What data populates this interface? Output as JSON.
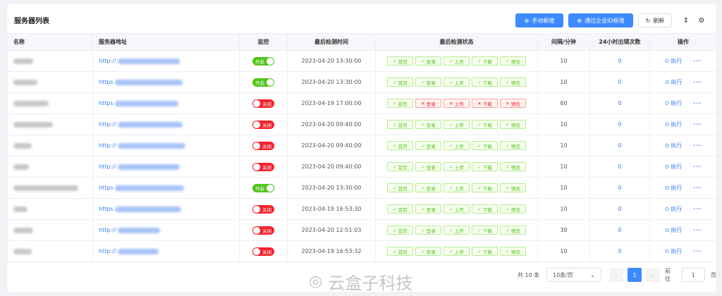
{
  "header": {
    "title": "服务器列表",
    "btn_manual_add": "手动新增",
    "btn_enterprise_add": "通过企业ID新增",
    "btn_refresh": "刷新"
  },
  "table": {
    "columns": [
      "名称",
      "服务器地址",
      "监控",
      "最后检测时间",
      "最后检测状态",
      "间隔/分钟",
      "24小时出错次数",
      "操作"
    ],
    "status_labels": [
      "首页",
      "登录",
      "上传",
      "下载",
      "预览"
    ],
    "action_label": "执行",
    "more_label": "···",
    "rows": [
      {
        "addr_prefix": "http://",
        "monitor": "开启",
        "monitor_on": true,
        "time": "2023-04-20 13:30:00",
        "status": [
          true,
          true,
          true,
          true,
          true
        ],
        "interval": "10",
        "errors": "0"
      },
      {
        "addr_prefix": "https",
        "monitor": "开启",
        "monitor_on": true,
        "time": "2023-04-20 13:30:00",
        "status": [
          true,
          true,
          true,
          true,
          true
        ],
        "interval": "10",
        "errors": "0"
      },
      {
        "addr_prefix": "https",
        "monitor": "关闭",
        "monitor_on": false,
        "time": "2023-04-19 17:00:00",
        "status": [
          true,
          false,
          false,
          false,
          false
        ],
        "interval": "60",
        "errors": "0"
      },
      {
        "addr_prefix": "http://",
        "monitor": "关闭",
        "monitor_on": false,
        "time": "2023-04-20 09:40:00",
        "status": [
          true,
          true,
          true,
          true,
          true
        ],
        "interval": "10",
        "errors": "0"
      },
      {
        "addr_prefix": "http://",
        "monitor": "关闭",
        "monitor_on": false,
        "time": "2023-04-20 09:40:00",
        "status": [
          true,
          true,
          true,
          true,
          true
        ],
        "interval": "10",
        "errors": "0"
      },
      {
        "addr_prefix": "http://",
        "monitor": "关闭",
        "monitor_on": false,
        "time": "2023-04-20 09:40:00",
        "status": [
          true,
          true,
          true,
          true,
          true
        ],
        "interval": "10",
        "errors": "0"
      },
      {
        "addr_prefix": "https",
        "monitor": "开启",
        "monitor_on": true,
        "time": "2023-04-20 13:30:00",
        "status": [
          true,
          true,
          true,
          true,
          true
        ],
        "interval": "10",
        "errors": "0"
      },
      {
        "addr_prefix": "https",
        "monitor": "关闭",
        "monitor_on": false,
        "time": "2023-04-19 16:53:30",
        "status": [
          true,
          true,
          true,
          true,
          true
        ],
        "interval": "10",
        "errors": "0"
      },
      {
        "addr_prefix": "http://",
        "monitor": "关闭",
        "monitor_on": false,
        "time": "2023-04-20 12:51:03",
        "status": [
          true,
          true,
          true,
          true,
          true
        ],
        "interval": "30",
        "errors": "0"
      },
      {
        "addr_prefix": "http://",
        "monitor": "关闭",
        "monitor_on": false,
        "time": "2023-04-19 16:53:32",
        "status": [
          true,
          true,
          true,
          true,
          true
        ],
        "interval": "10",
        "errors": "0"
      }
    ]
  },
  "pagination": {
    "total": "共 10 条",
    "page_size": "10条/页",
    "current_page": "1",
    "goto_label": "前往",
    "goto_value": "1",
    "page_unit": "页"
  },
  "watermark": "云盒子科技",
  "colors": {
    "primary": "#3d8bff",
    "ok": "#52c41a",
    "err": "#f5222d"
  }
}
